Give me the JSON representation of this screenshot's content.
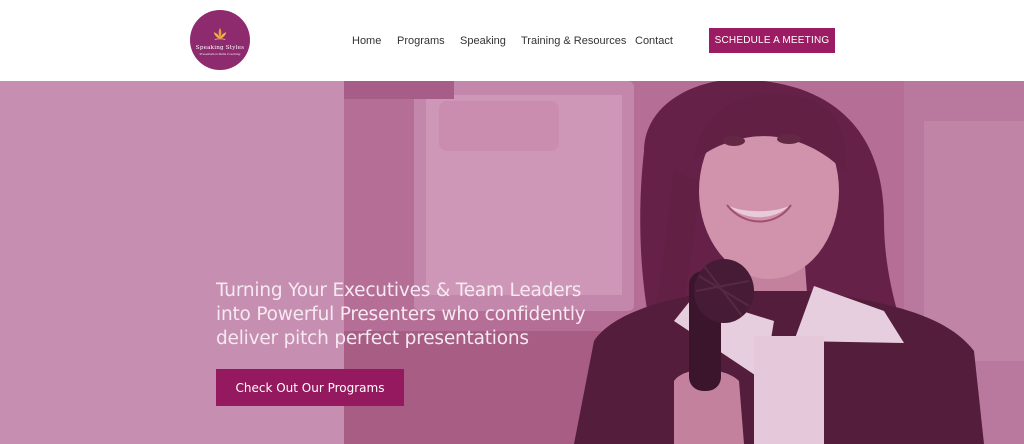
{
  "brand": {
    "name": "Speaking Styles",
    "tagline": "Presentation Skills Coaching",
    "primary_color": "#9b1c62",
    "logo_color": "#8e2a6e"
  },
  "nav": {
    "items": [
      "Home",
      "Programs",
      "Speaking",
      "Training & Resources",
      "Contact"
    ],
    "cta_label": "SCHEDULE A MEETING"
  },
  "hero": {
    "headline": "Turning Your Executives & Team Leaders into Powerful Presenters who confidently deliver pitch perfect presentations",
    "button_label": "Check Out Our Programs",
    "overlay_color": "#c68fb1"
  }
}
